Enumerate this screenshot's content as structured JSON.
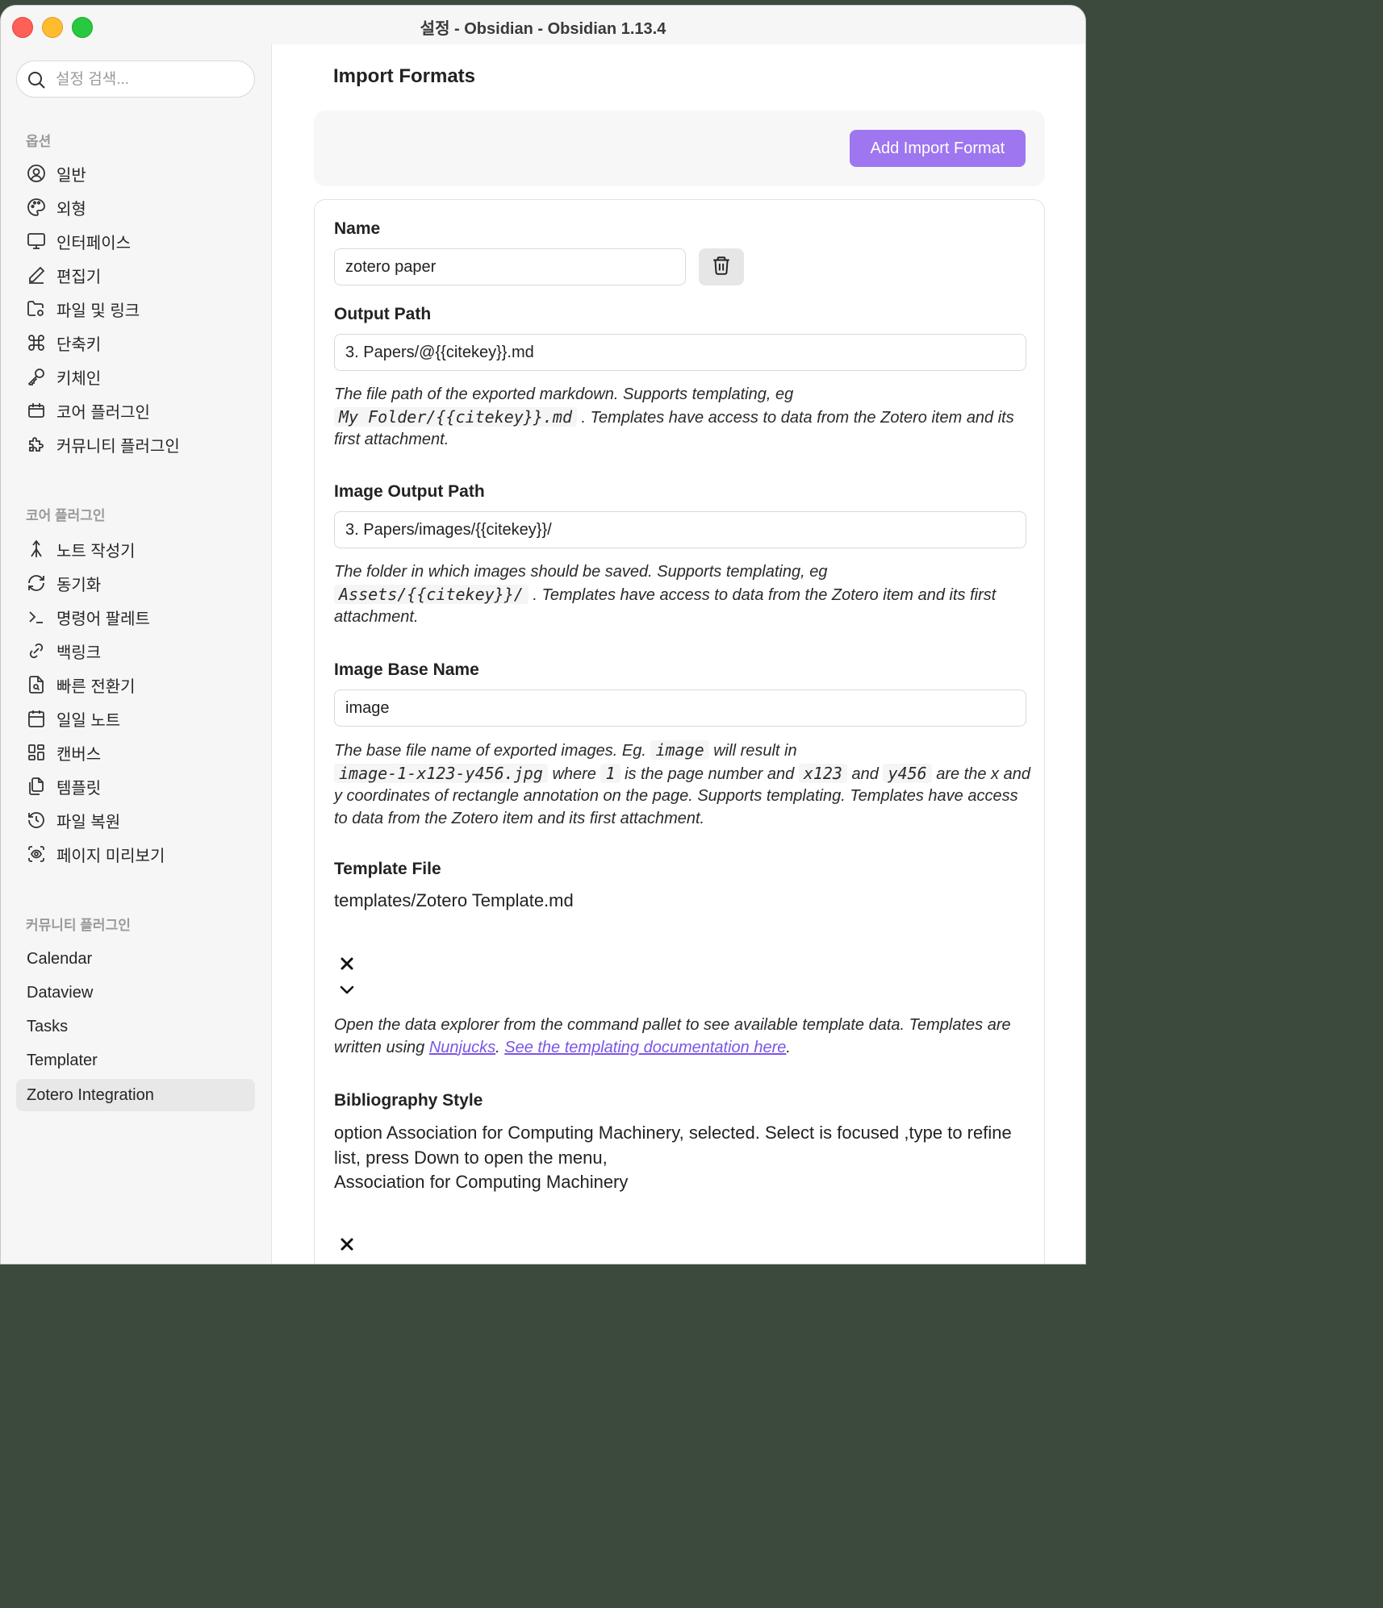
{
  "window": {
    "title": "설정 - Obsidian - Obsidian 1.13.4"
  },
  "sidebar": {
    "search_placeholder": "설정 검색...",
    "options_title": "옵션",
    "options": [
      {
        "label": "일반",
        "icon": "user-circle-icon"
      },
      {
        "label": "외형",
        "icon": "palette-icon"
      },
      {
        "label": "인터페이스",
        "icon": "monitor-icon"
      },
      {
        "label": "편집기",
        "icon": "pencil-icon"
      },
      {
        "label": "파일 및 링크",
        "icon": "folder-cog-icon"
      },
      {
        "label": "단축키",
        "icon": "command-icon"
      },
      {
        "label": "키체인",
        "icon": "key-icon"
      },
      {
        "label": "코어 플러그인",
        "icon": "calendar-plug-icon"
      },
      {
        "label": "커뮤니티 플러그인",
        "icon": "puzzle-icon"
      }
    ],
    "core_title": "코어 플러그인",
    "core": [
      {
        "label": "노트 작성기",
        "icon": "merge-icon"
      },
      {
        "label": "동기화",
        "icon": "refresh-icon"
      },
      {
        "label": "명령어 팔레트",
        "icon": "terminal-icon"
      },
      {
        "label": "백링크",
        "icon": "backlink-icon"
      },
      {
        "label": "빠른 전환기",
        "icon": "file-search-icon"
      },
      {
        "label": "일일 노트",
        "icon": "calendar-icon"
      },
      {
        "label": "캔버스",
        "icon": "layout-dashboard-icon"
      },
      {
        "label": "템플릿",
        "icon": "files-icon"
      },
      {
        "label": "파일 복원",
        "icon": "history-icon"
      },
      {
        "label": "페이지 미리보기",
        "icon": "scan-eye-icon"
      }
    ],
    "community_title": "커뮤니티 플러그인",
    "community": [
      "Calendar",
      "Dataview",
      "Tasks",
      "Templater",
      "Zotero Integration"
    ],
    "active_item": "Zotero Integration"
  },
  "main": {
    "heading": "Import Formats",
    "add_button": "Add Import Format",
    "name_label": "Name",
    "name_value": "zotero paper",
    "output_label": "Output Path",
    "output_value": "3. Papers/@{{citekey}}.md",
    "output_desc_1": "The file path of the exported markdown. Supports templating, eg",
    "output_desc_code": "My Folder/{{citekey}}.md",
    "output_desc_2": ". Templates have access to data from the Zotero item and its first attachment.",
    "img_out_label": "Image Output Path",
    "img_out_value": "3. Papers/images/{{citekey}}/",
    "img_out_desc_1": "The folder in which images should be saved. Supports templating, eg",
    "img_out_desc_code": "Assets/{{citekey}}/",
    "img_out_desc_2": ". Templates have access to data from the Zotero item and its first attachment.",
    "img_base_label": "Image Base Name",
    "img_base_value": "image",
    "img_base_desc_1": "The base file name of exported images. Eg.",
    "img_base_desc_code1": "image",
    "img_base_desc_2": "will result in",
    "img_base_desc_code2": "image-1-x123-y456.jpg",
    "img_base_desc_3": "where",
    "img_base_desc_code3": "1",
    "img_base_desc_4": "is the page number and",
    "img_base_desc_code4": "x123",
    "img_base_desc_5": "and",
    "img_base_desc_code5": "y456",
    "img_base_desc_6": "are the x and y coordinates of rectangle annotation on the page. Supports templating. Templates have access to data from the Zotero item and its first attachment.",
    "template_label": "Template File",
    "template_value": "templates/Zotero Template.md",
    "template_desc_1": "Open the data explorer from the command pallet to see available template data. Templates are written using",
    "template_link_1": "Nunjucks",
    "template_desc_sep": ".",
    "template_link_2": "See the templating documentation here",
    "template_desc_end": ".",
    "bib_label": "Bibliography Style",
    "bib_aria_1": "option Association for Computing Machinery, selected. Select is focused ,type to refine list, press Down to open the menu,",
    "bib_value": "Association for Computing Machinery"
  },
  "colors": {
    "accent": "#9d76f0",
    "link": "#7b55e6"
  }
}
